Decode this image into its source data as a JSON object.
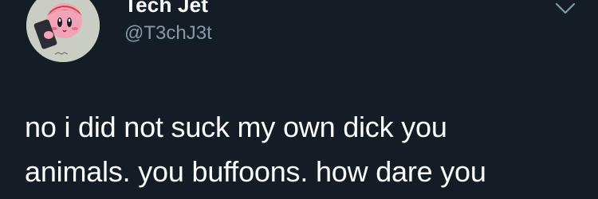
{
  "author": {
    "display_name": "Tech Jet",
    "handle": "@T3chJ3t",
    "avatar_icon": "kirby-avatar-icon"
  },
  "tweet": {
    "text": "no i did not suck my own dick you\nanimals. you buffoons. how dare you"
  },
  "menu": {
    "icon": "chevron-down-icon"
  },
  "colors": {
    "background": "#141d26",
    "text_primary": "#ffffff",
    "text_secondary": "#8899a6",
    "icon": "#8899a6"
  }
}
